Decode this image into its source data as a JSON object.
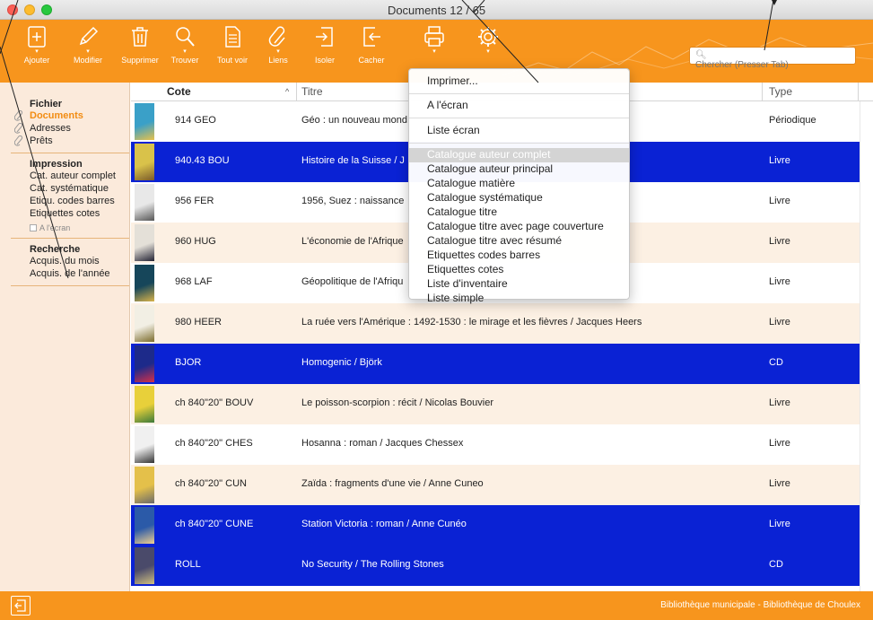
{
  "window": {
    "title": "Documents 12 / 65"
  },
  "toolbar": {
    "buttons": [
      {
        "label": "Ajouter",
        "icon": "plus-square-icon"
      },
      {
        "label": "Modifier",
        "icon": "pencil-icon"
      },
      {
        "label": "Supprimer",
        "icon": "trash-icon"
      },
      {
        "label": "Trouver",
        "icon": "magnifier-icon"
      },
      {
        "label": "Tout voir",
        "icon": "document-icon"
      },
      {
        "label": "Liens",
        "icon": "paperclip-icon"
      },
      {
        "label": "Isoler",
        "icon": "isolate-icon"
      },
      {
        "label": "Cacher",
        "icon": "hide-icon"
      },
      {
        "label": "",
        "icon": "printer-icon"
      },
      {
        "label": "",
        "icon": "gear-icon"
      }
    ],
    "search_placeholder": "Chercher (Presser Tab)"
  },
  "sidebar": {
    "fichier": {
      "heading": "Fichier",
      "items": [
        "Documents",
        "Adresses",
        "Prêts"
      ]
    },
    "impression": {
      "heading": "Impression",
      "items": [
        "Cat. auteur complet",
        "Cat. systématique",
        "Etiqu. codes barres",
        "Etiquettes cotes"
      ],
      "checkbox_label": "A l'écran"
    },
    "recherche": {
      "heading": "Recherche",
      "items": [
        "Acquis. du mois",
        "Acquis. de l'année"
      ]
    }
  },
  "table": {
    "columns": {
      "cote": "Cote",
      "titre": "Titre",
      "type": "Type"
    },
    "rows": [
      {
        "cote": "914 GEO",
        "titre": "Géo : un nouveau mond",
        "type": "Périodique",
        "selected": false
      },
      {
        "cote": "940.43 BOU",
        "titre": "Histoire de la Suisse / J",
        "type": "Livre",
        "selected": true
      },
      {
        "cote": "956 FER",
        "titre": "1956, Suez : naissance",
        "type": "Livre",
        "selected": false
      },
      {
        "cote": "960 HUG",
        "titre": "L'économie de l'Afrique",
        "type": "Livre",
        "selected": false
      },
      {
        "cote": "968 LAF",
        "titre": "Géopolitique de l'Afriqu",
        "type": "Livre",
        "selected": false
      },
      {
        "cote": "980 HEER",
        "titre": "La ruée vers l'Amérique : 1492-1530 : le mirage et les fièvres / Jacques Heers",
        "type": "Livre",
        "selected": false
      },
      {
        "cote": "BJOR",
        "titre": "Homogenic / Björk",
        "type": "CD",
        "selected": true
      },
      {
        "cote": "ch 840\"20\" BOUV",
        "titre": "Le poisson-scorpion : récit / Nicolas Bouvier",
        "type": "Livre",
        "selected": false
      },
      {
        "cote": "ch 840\"20\" CHES",
        "titre": "Hosanna : roman / Jacques Chessex",
        "type": "Livre",
        "selected": false
      },
      {
        "cote": "ch 840\"20\" CUN",
        "titre": "Zaïda : fragments d'une vie / Anne Cuneo",
        "type": "Livre",
        "selected": false
      },
      {
        "cote": "ch 840\"20\" CUNE",
        "titre": "Station Victoria : roman / Anne Cunéo",
        "type": "Livre",
        "selected": true
      },
      {
        "cote": "ROLL",
        "titre": "No Security / The Rolling Stones",
        "type": "CD",
        "selected": true
      }
    ]
  },
  "menu": {
    "items": [
      "Imprimer...",
      "A l'écran",
      "Liste écran",
      "Catalogue auteur complet",
      "Catalogue auteur principal",
      "Catalogue matière",
      "Catalogue systématique",
      "Catalogue titre",
      "Catalogue titre avec page couverture",
      "Catalogue titre avec résumé",
      "Etiquettes codes barres",
      "Etiquettes cotes",
      "Liste d'inventaire",
      "Liste simple"
    ],
    "highlighted_index": 3
  },
  "statusbar": {
    "text": "Bibliothèque municipale - Bibliothèque de Choulex"
  },
  "colors": {
    "accent": "#f7951d",
    "selection": "#0a22d4",
    "row_alt": "#fcf0e3",
    "sidebar": "#fbeadb",
    "menu_highlight": "#d4d4d4"
  }
}
